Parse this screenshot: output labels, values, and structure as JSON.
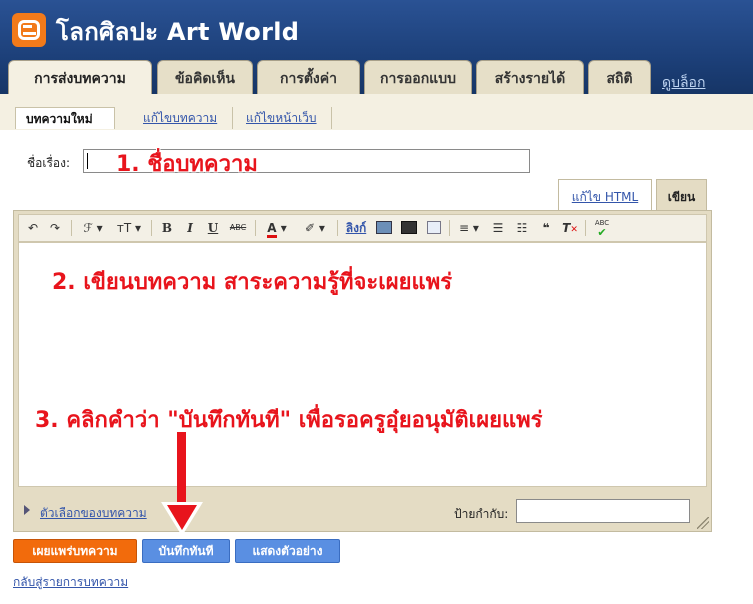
{
  "header": {
    "blog_title": "โลกศิลปะ Art World",
    "tabs": [
      {
        "label": "การส่งบทความ",
        "active": true
      },
      {
        "label": "ข้อคิดเห็น"
      },
      {
        "label": "การตั้งค่า"
      },
      {
        "label": "การออกแบบ"
      },
      {
        "label": "สร้างรายได้"
      },
      {
        "label": "สถิติ"
      }
    ],
    "view_blog_link": "ดูบล็อก"
  },
  "subnav": {
    "items": [
      {
        "label": "บทความใหม่",
        "active": true
      },
      {
        "label": "แก้ไขบทความ"
      },
      {
        "label": "แก้ไขหน้าเว็บ"
      }
    ]
  },
  "post": {
    "title_label": "ชื่อเรื่อง:",
    "title_value": ""
  },
  "editor": {
    "mode_html": "แก้ไข HTML",
    "mode_compose": "เขียน",
    "toolbar": {
      "undo": "↶",
      "redo": "↷",
      "font": "ℱ",
      "size": "тT",
      "bold": "B",
      "italic": "I",
      "underline": "U",
      "strike": "ABC",
      "text_color": "A",
      "highlight": "✐",
      "link": "ลิงก์",
      "spell": "ABC",
      "quote": "❝",
      "remove_format": "T"
    },
    "options_link": "ตัวเลือกของบทความ",
    "tags_label": "ป้ายกำกับ:"
  },
  "buttons": {
    "publish": "เผยแพร่บทความ",
    "save_now": "บันทึกทันที",
    "preview": "แสดงตัวอย่าง"
  },
  "back_link": "กลับสู่รายการบทความ",
  "annotations": {
    "step1": "1. ชื่อบทความ",
    "step2": "2. เขียนบทความ สาระความรู้ที่จะเผยแพร่",
    "step3": "3. คลิกคำว่า \"บันทึกทันที\" เพื่อรอครูอุ๋ยอนุมัติเผยแพร่"
  },
  "colors": {
    "header_bg": "#1c3f78",
    "accent_orange": "#f26b0c",
    "button_blue": "#5a8fe2",
    "annotation_red": "#e8141c",
    "link_blue": "#3355aa"
  }
}
